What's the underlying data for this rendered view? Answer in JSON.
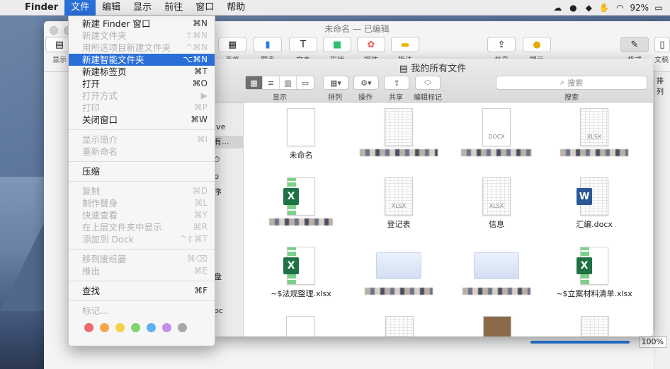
{
  "menubar": {
    "app": "Finder",
    "items": [
      "文件",
      "编辑",
      "显示",
      "前往",
      "窗口",
      "帮助"
    ],
    "battery": "92%"
  },
  "pages_window": {
    "title": "未命名 — 已编辑",
    "toolbar_labels": [
      "显示",
      "表格",
      "图表",
      "文本",
      "形状",
      "媒体",
      "批注",
      "共享",
      "提示",
      "格式",
      "文稿"
    ],
    "sidebar_partial": "排列",
    "zoom": "100%"
  },
  "finder": {
    "title": "我的所有文件",
    "toolbar_labels": {
      "view": "显示",
      "arrange": "排列",
      "action": "操作",
      "share": "共享",
      "tags": "编辑标记",
      "search": "搜索"
    },
    "search_placeholder": "搜索",
    "sidebar": [
      "ive",
      "有...",
      "",
      "p",
      "序",
      "盘",
      "pc"
    ],
    "files": [
      {
        "name": "未命名",
        "kind": "doc"
      },
      {
        "name": "",
        "kind": "doc-lines"
      },
      {
        "name": "",
        "kind": "docx",
        "tag": "DOCX"
      },
      {
        "name": "",
        "kind": "xlsx-gray",
        "tag": "XLSX"
      },
      {
        "name": "",
        "kind": "excel"
      },
      {
        "name": "登记表",
        "kind": "xlsx-gray",
        "tag": "XLSX"
      },
      {
        "name": "信息",
        "kind": "xlsx-gray",
        "tag": "XLSX"
      },
      {
        "name": "汇编.docx",
        "kind": "word"
      },
      {
        "name": "~$法规整理.xlsx",
        "kind": "excel"
      },
      {
        "name": "",
        "kind": "mind"
      },
      {
        "name": "",
        "kind": "mind"
      },
      {
        "name": "~$立案材料清单.xlsx",
        "kind": "excel"
      }
    ]
  },
  "file_menu": {
    "items": [
      {
        "label": "新建 Finder 窗口",
        "shortcut": "⌘N",
        "disabled": false,
        "highlight": false
      },
      {
        "label": "新建文件夹",
        "shortcut": "⇧⌘N",
        "disabled": true,
        "highlight": false
      },
      {
        "label": "用所选项目新建文件夹",
        "shortcut": "^⌘N",
        "disabled": true,
        "highlight": false
      },
      {
        "label": "新建智能文件夹",
        "shortcut": "⌥⌘N",
        "disabled": false,
        "highlight": true
      },
      {
        "label": "新建标签页",
        "shortcut": "⌘T",
        "disabled": false,
        "highlight": false
      },
      {
        "label": "打开",
        "shortcut": "⌘O",
        "disabled": false,
        "highlight": false
      },
      {
        "label": "打开方式",
        "shortcut": "▶",
        "disabled": true,
        "highlight": false
      },
      {
        "label": "打印",
        "shortcut": "⌘P",
        "disabled": true,
        "highlight": false
      },
      {
        "label": "关闭窗口",
        "shortcut": "⌘W",
        "disabled": false,
        "highlight": false
      },
      {
        "sep": true
      },
      {
        "label": "显示简介",
        "shortcut": "⌘I",
        "disabled": true,
        "highlight": false
      },
      {
        "label": "重新命名",
        "shortcut": "",
        "disabled": true,
        "highlight": false
      },
      {
        "sep": true
      },
      {
        "label": "压缩",
        "shortcut": "",
        "disabled": false,
        "highlight": false
      },
      {
        "sep": true
      },
      {
        "label": "复制",
        "shortcut": "⌘D",
        "disabled": true,
        "highlight": false
      },
      {
        "label": "制作替身",
        "shortcut": "⌘L",
        "disabled": true,
        "highlight": false
      },
      {
        "label": "快速查看",
        "shortcut": "⌘Y",
        "disabled": true,
        "highlight": false
      },
      {
        "label": "在上层文件夹中显示",
        "shortcut": "⌘R",
        "disabled": true,
        "highlight": false
      },
      {
        "label": "添加到 Dock",
        "shortcut": "^⇧⌘T",
        "disabled": true,
        "highlight": false
      },
      {
        "sep": true
      },
      {
        "label": "移到废纸篓",
        "shortcut": "⌘⌫",
        "disabled": true,
        "highlight": false
      },
      {
        "label": "推出",
        "shortcut": "⌘E",
        "disabled": true,
        "highlight": false
      },
      {
        "sep": true
      },
      {
        "label": "查找",
        "shortcut": "⌘F",
        "disabled": false,
        "highlight": false
      },
      {
        "sep": true
      },
      {
        "label": "标记...",
        "shortcut": "",
        "disabled": true,
        "highlight": false
      }
    ],
    "tag_colors": [
      "#f06a6a",
      "#f5a54a",
      "#f3d24a",
      "#7ed36a",
      "#5db2f0",
      "#c58ee8",
      "#a8a8a8"
    ]
  }
}
